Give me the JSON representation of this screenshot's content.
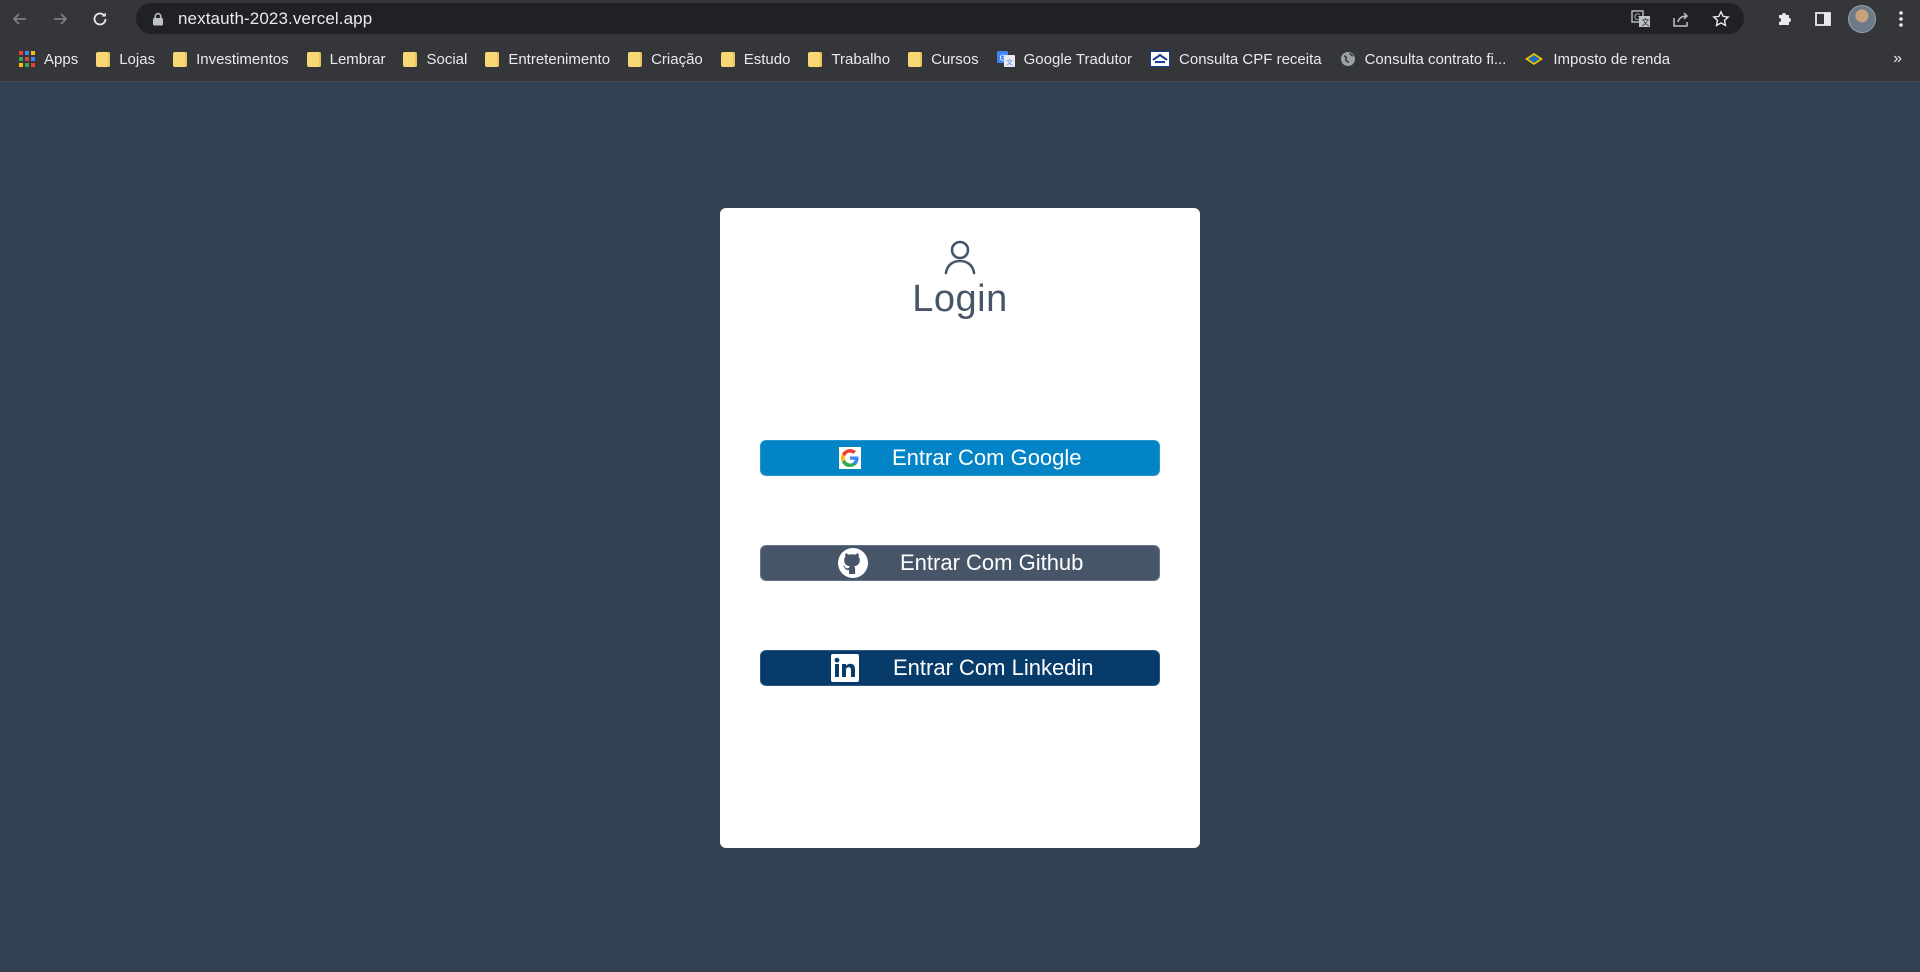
{
  "browser": {
    "url": "nextauth-2023.vercel.app",
    "bookmarks": [
      {
        "label": "Apps",
        "icon": "apps-grid-icon"
      },
      {
        "label": "Lojas",
        "icon": "folder-icon"
      },
      {
        "label": "Investimentos",
        "icon": "folder-icon"
      },
      {
        "label": "Lembrar",
        "icon": "folder-icon"
      },
      {
        "label": "Social",
        "icon": "folder-icon"
      },
      {
        "label": "Entretenimento",
        "icon": "folder-icon"
      },
      {
        "label": "Criação",
        "icon": "folder-icon"
      },
      {
        "label": "Estudo",
        "icon": "folder-icon"
      },
      {
        "label": "Trabalho",
        "icon": "folder-icon"
      },
      {
        "label": "Cursos",
        "icon": "folder-icon"
      },
      {
        "label": "Google Tradutor",
        "icon": "google-translate-icon"
      },
      {
        "label": "Consulta CPF receita",
        "icon": "receita-icon"
      },
      {
        "label": "Consulta contrato fi...",
        "icon": "globe-icon"
      },
      {
        "label": "Imposto de renda",
        "icon": "imposto-icon"
      }
    ],
    "more_label": "»"
  },
  "login": {
    "title": "Login",
    "buttons": {
      "google": "Entrar Com Google",
      "github": "Entrar Com Github",
      "linkedin": "Entrar Com Linkedin"
    }
  },
  "colors": {
    "page_bg": "#334155",
    "google_btn": "#0284c7",
    "github_btn": "#475569",
    "linkedin_btn": "#073b6a"
  }
}
